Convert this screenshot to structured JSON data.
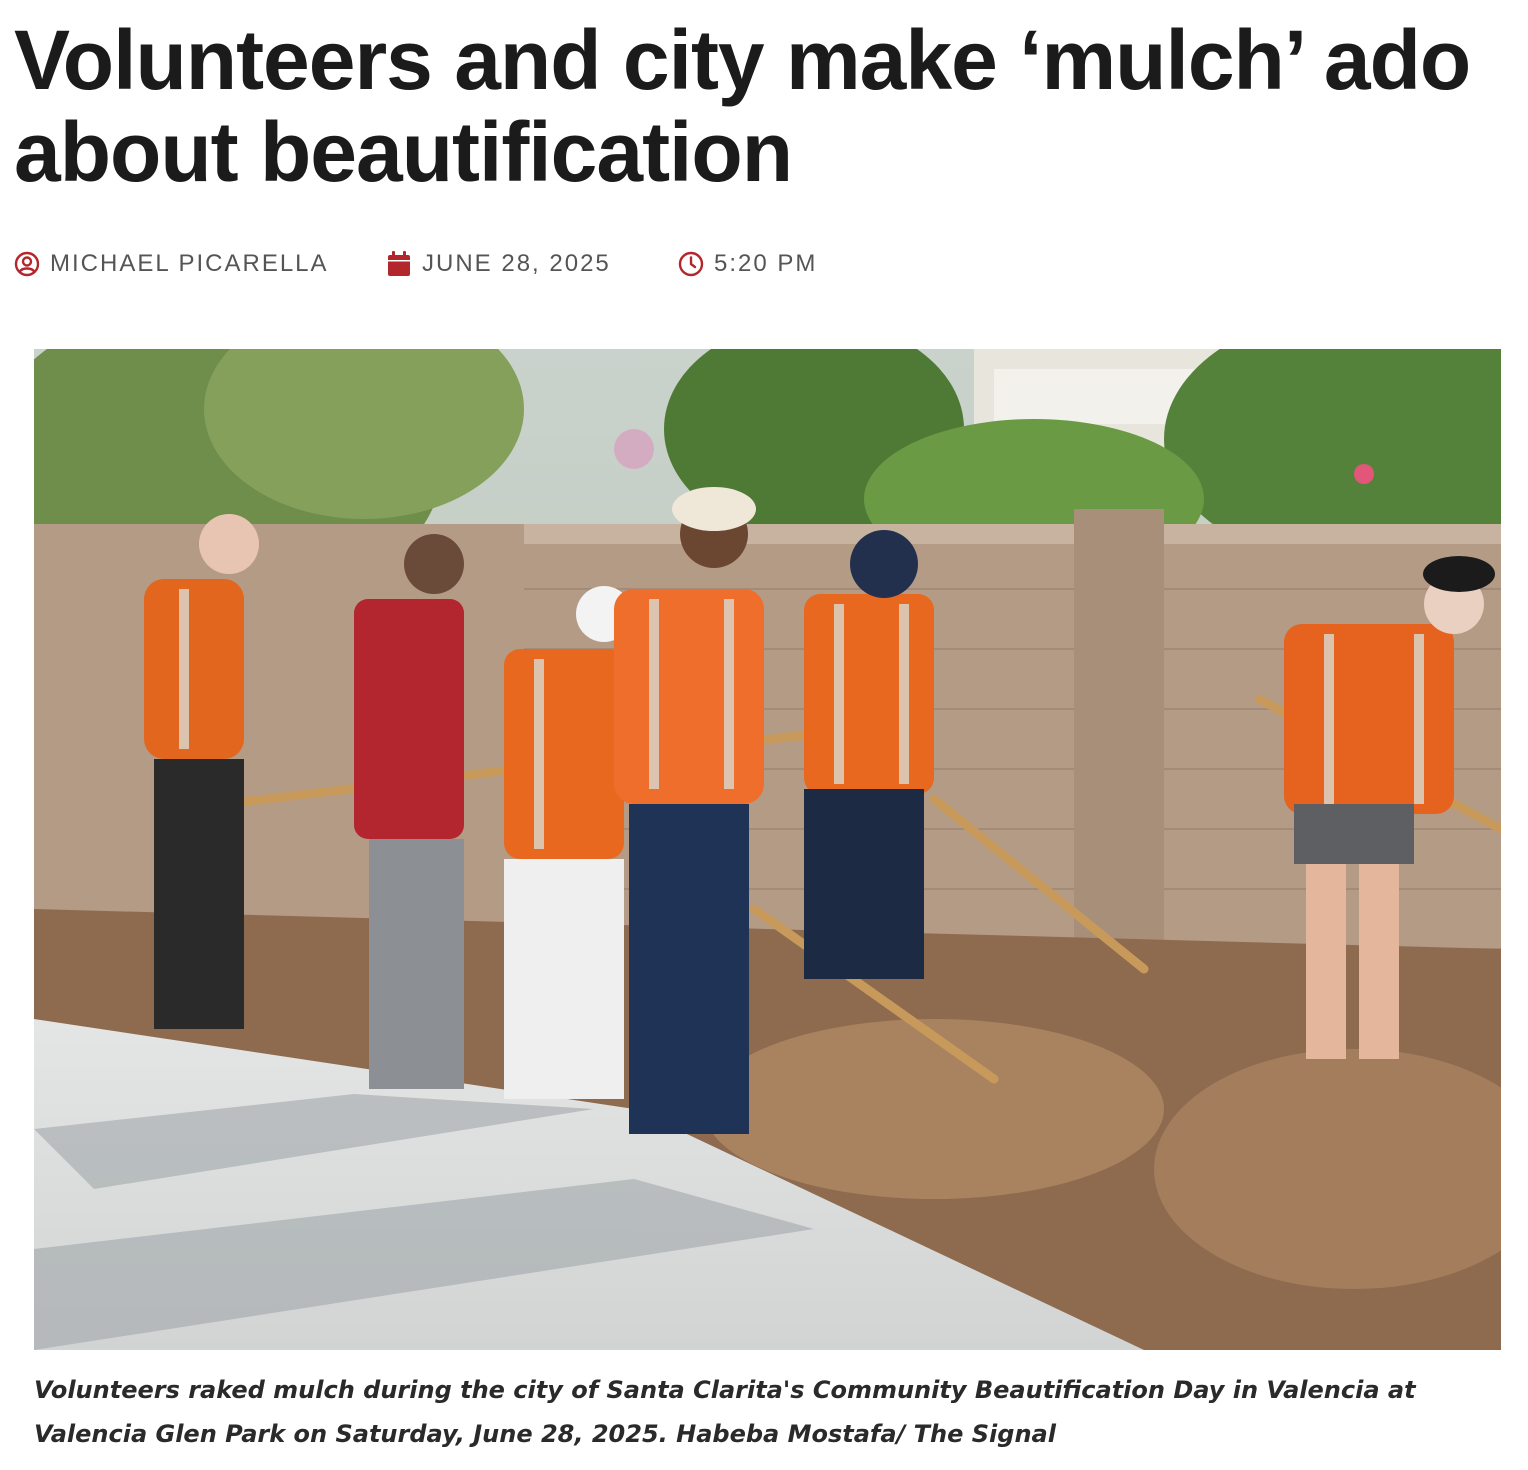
{
  "article": {
    "headline_line1": "Volunteers and city make ‘mulch’ ado",
    "headline_line2": "about beautification",
    "author": "MICHAEL PICARELLA",
    "date": "JUNE 28, 2025",
    "time": "5:20 PM",
    "photo_caption": "Volunteers raked mulch during the city of Santa Clarita's Community Beautification Day in Valencia at Valencia Glen Park on Saturday, June 28, 2025. Habeba Mostafa/ The Signal"
  },
  "icons": {
    "author": "user-circle-icon",
    "date": "calendar-icon",
    "time": "clock-icon"
  },
  "colors": {
    "accent": "#b3262b",
    "meta_text": "#555555",
    "headline": "#1b1b1b"
  }
}
